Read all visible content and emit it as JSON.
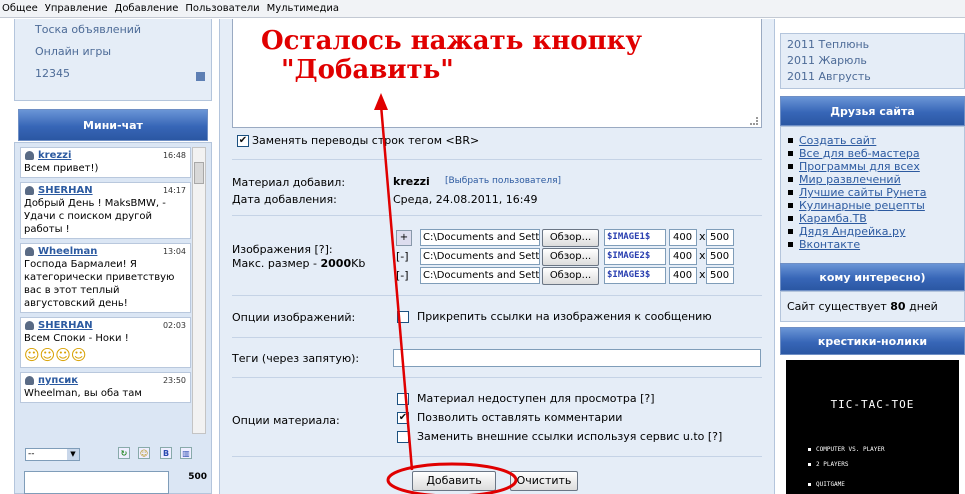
{
  "topmenu": {
    "items": [
      "Общее",
      "Управление",
      "Добавление",
      "Пользователи",
      "Мультимедиа"
    ]
  },
  "leftnav": {
    "items": [
      "Тоска объявлений",
      "Онлайн игры",
      "12345"
    ]
  },
  "minichat": {
    "title": "Мини-чат",
    "messages": [
      {
        "author": "krezzi",
        "time": "16:48",
        "text": "Всем привет!)"
      },
      {
        "author": "SHERHAN",
        "time": "14:17",
        "text": "Добрый День ! MaksBMW, - Удачи с поиском другой работы !"
      },
      {
        "author": "Wheelman",
        "time": "13:04",
        "text": "Господа Бармалеи! Я категорически приветствую вас в этот теплый августовский день!"
      },
      {
        "author": "SHERHAN",
        "time": "02:03",
        "text": "Всем Споки - Ноки !"
      },
      {
        "author": "пупсик",
        "time": "23:50",
        "text": "Wheelman, вы оба там"
      }
    ],
    "select_value": "--",
    "counter": "500"
  },
  "form": {
    "annotation_line1": "Осталось нажать кнопку",
    "annotation_line2": "\"Добавить\"",
    "br_label": "Заменять переводы строк тегом <BR>",
    "added_by_label": "Материал добавил:",
    "added_by_value": "krezzi",
    "choose_user": "[Выбрать пользователя]",
    "date_label": "Дата добавления:",
    "date_value": "Среда, 24.08.2011, 16:49",
    "images_label": "Изображения [?]:",
    "max_size_label": "Макс. размер - ",
    "max_size_value": "2000",
    "max_size_unit": "Kb",
    "files": [
      {
        "ctl": "+",
        "path": "C:\\Documents and Setti",
        "browse": "Обзор...",
        "tag": "$IMAGE1$",
        "w": "400",
        "h": "500"
      },
      {
        "ctl": "[-]",
        "path": "C:\\Documents and Setti",
        "browse": "Обзор...",
        "tag": "$IMAGE2$",
        "w": "400",
        "h": "500"
      },
      {
        "ctl": "[-]",
        "path": "C:\\Documents and Setti",
        "browse": "Обзор...",
        "tag": "$IMAGE3$",
        "w": "400",
        "h": "500"
      }
    ],
    "x_sep": "x",
    "img_options_label": "Опции изображений:",
    "attach_links_label": "Прикрепить ссылки на изображения к сообщению",
    "tags_label": "Теги (через запятую):",
    "material_options_label": "Опции материала:",
    "opt1": "Материал недоступен для просмотра [?]",
    "opt2": "Позволить оставлять комментарии",
    "opt3": "Заменить внешние ссылки используя сервис u.to [?]",
    "submit": "Добавить",
    "clear": "Очистить"
  },
  "right": {
    "archive": [
      "2011 Теплюнь",
      "2011 Жарюль",
      "2011 Авгрусть"
    ],
    "friends_title": "Друзья сайта",
    "friends": [
      "Создать сайт",
      "Все для веб-мастера",
      "Программы для всех",
      "Мир развлечений",
      "Лучшие сайты Рунета",
      "Кулинарные рецепты",
      "Карамба.ТВ",
      "Дядя Андрейка.ру",
      "Вконтакте"
    ],
    "interest_title": "кому интересно)",
    "site_age_prefix": "Сайт существует ",
    "site_age_value": "80",
    "site_age_suffix": " дней",
    "game_title": "крестики-нолики",
    "game_name": "TIC-TAC-TOE",
    "game_options": [
      "COMPUTER VS. PLAYER",
      "2 PLAYERS",
      "QUITGAME"
    ]
  },
  "colors": {
    "accent_red": "#e00000",
    "block_header": "#3766b7",
    "panel_bg": "#e5edf7"
  }
}
